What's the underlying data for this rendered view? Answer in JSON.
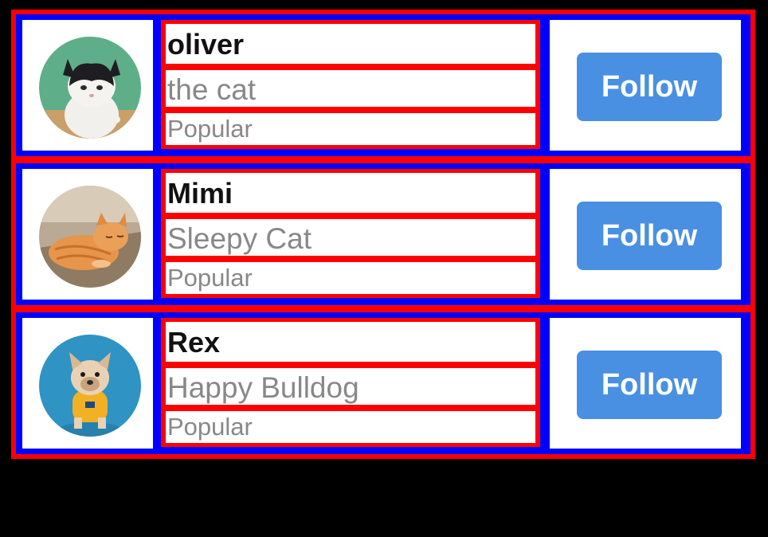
{
  "users": [
    {
      "name": "oliver",
      "subtitle": "the cat",
      "badge": "Popular",
      "button_label": "Follow",
      "avatar": "cat-avatar"
    },
    {
      "name": "Mimi",
      "subtitle": "Sleepy Cat",
      "badge": "Popular",
      "button_label": "Follow",
      "avatar": "cat-avatar"
    },
    {
      "name": "Rex",
      "subtitle": "Happy Bulldog",
      "badge": "Popular",
      "button_label": "Follow",
      "avatar": "dog-avatar"
    }
  ],
  "colors": {
    "button": "#4a90e2",
    "outer_frame": "#ff0000",
    "inner_frame": "#0000ff"
  }
}
